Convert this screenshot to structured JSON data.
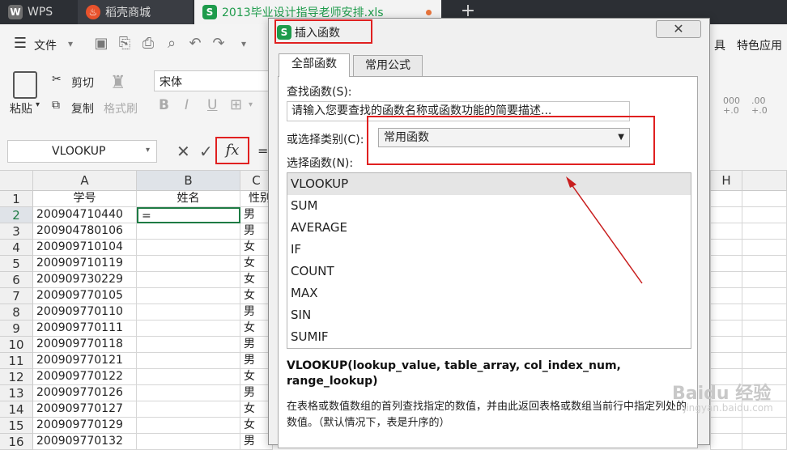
{
  "tabs": {
    "wps_label": "WPS",
    "store_label": "稻壳商城",
    "file_label": "2013毕业设计指导老师安排.xls",
    "file_badge": "S"
  },
  "menu": {
    "file_label": "文件",
    "special_app": "特色应用",
    "right_char": "具"
  },
  "ribbon": {
    "paste_label": "粘贴",
    "cut_label": "剪切",
    "copy_label": "复制",
    "format_painter_label": "格式刷",
    "font_name": "宋体",
    "num_fmt_1": "000",
    "num_fmt_2": "+.0",
    "num_fmt_3": ".00",
    "num_fmt_4": "+.0"
  },
  "formula_bar": {
    "name_box": "VLOOKUP",
    "fx_label": "fx",
    "equals": "="
  },
  "sheet": {
    "columns": [
      "A",
      "B",
      "C",
      "H"
    ],
    "header_row": [
      "学号",
      "姓名",
      "性别"
    ],
    "active_cell_value": "=",
    "rows": [
      {
        "n": "1",
        "a": "学号",
        "b": "姓名",
        "c": "性别"
      },
      {
        "n": "2",
        "a": "200904710440",
        "b": "=",
        "c": "男"
      },
      {
        "n": "3",
        "a": "200904780106",
        "b": "",
        "c": "男"
      },
      {
        "n": "4",
        "a": "200909710104",
        "b": "",
        "c": "女"
      },
      {
        "n": "5",
        "a": "200909710119",
        "b": "",
        "c": "女"
      },
      {
        "n": "6",
        "a": "200909730229",
        "b": "",
        "c": "女"
      },
      {
        "n": "7",
        "a": "200909770105",
        "b": "",
        "c": "女"
      },
      {
        "n": "8",
        "a": "200909770110",
        "b": "",
        "c": "男"
      },
      {
        "n": "9",
        "a": "200909770111",
        "b": "",
        "c": "女"
      },
      {
        "n": "10",
        "a": "200909770118",
        "b": "",
        "c": "男"
      },
      {
        "n": "11",
        "a": "200909770121",
        "b": "",
        "c": "男"
      },
      {
        "n": "12",
        "a": "200909770122",
        "b": "",
        "c": "女"
      },
      {
        "n": "13",
        "a": "200909770126",
        "b": "",
        "c": "男"
      },
      {
        "n": "14",
        "a": "200909770127",
        "b": "",
        "c": "女"
      },
      {
        "n": "15",
        "a": "200909770129",
        "b": "",
        "c": "女"
      },
      {
        "n": "16",
        "a": "200909770132",
        "b": "",
        "c": "男"
      }
    ]
  },
  "dialog": {
    "title": "插入函数",
    "badge": "S",
    "close": "✕",
    "tab_all": "全部函数",
    "tab_common": "常用公式",
    "search_label": "查找函数(S):",
    "search_placeholder": "请输入您要查找的函数名称或函数功能的简要描述...",
    "category_label": "或选择类别(C):",
    "category_value": "常用函数",
    "list_label": "选择函数(N):",
    "functions": [
      "VLOOKUP",
      "SUM",
      "AVERAGE",
      "IF",
      "COUNT",
      "MAX",
      "SIN",
      "SUMIF"
    ],
    "selected_function": "VLOOKUP",
    "signature": "VLOOKUP(lookup_value, table_array, col_index_num, range_lookup)",
    "description": "在表格或数值数组的首列查找指定的数值，并由此返回表格或数组当前行中指定列处的数值。（默认情况下，表是升序的）"
  },
  "watermark": {
    "main": "Baidu 经验",
    "sub": "jingyan.baidu.com"
  },
  "colors": {
    "accent_red": "#e02020",
    "green": "#1e9b4b",
    "tabbar": "#2c2f34"
  }
}
